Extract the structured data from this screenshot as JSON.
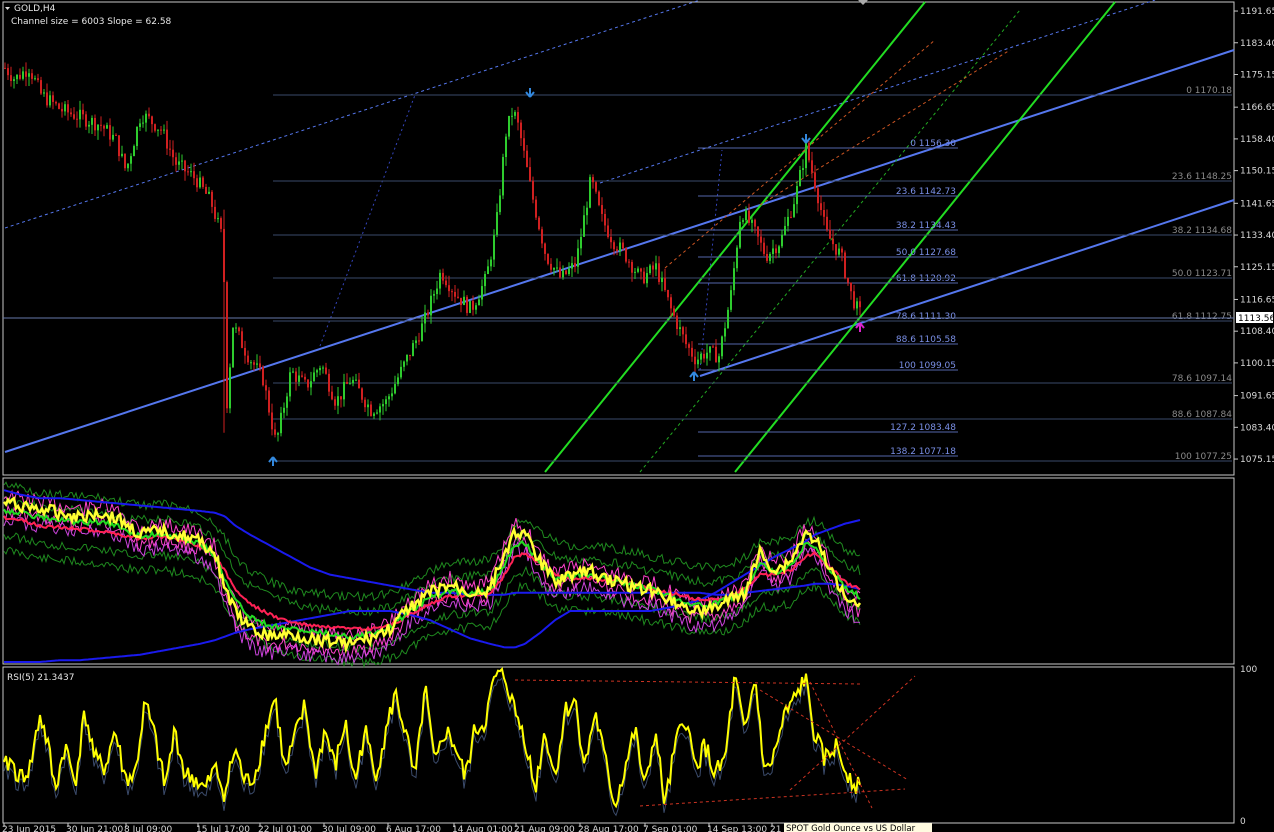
{
  "header": {
    "symbol_title": "GOLD,H4",
    "channel_info": "Channel size = 6003 Slope = 62.58",
    "rsi_title": "RSI(5) 21.3437"
  },
  "bottom_label": "SPOT Gold Ounce vs US Dollar",
  "colors": {
    "background": "#000000",
    "bull_candle": "#2ecc2e",
    "bear_candle": "#d02020",
    "channel_line": "#5577ee",
    "green_channel": "#22dd22",
    "fib_text": "#7a8fe6",
    "rsi_line": "#ffff00",
    "ma_yellow": "#ffff33",
    "ma_blue": "#1a1aee",
    "ma_magenta": "#ff44cc",
    "ma_green": "#1f8a1f",
    "current_price_box": "#ffffff"
  },
  "chart_data": [
    {
      "type": "line",
      "title": "GOLD,H4",
      "ylim": [
        1071,
        1194
      ],
      "y_ticks": [
        "1191.65",
        "1183.40",
        "1175.15",
        "1166.65",
        "1158.40",
        "1150.15",
        "1141.65",
        "1133.40",
        "1125.15",
        "1116.65",
        "1108.40",
        "1100.15",
        "1091.65",
        "1083.40",
        "1075.15"
      ],
      "current_price": "1113.56",
      "x_ticks": [
        "23 Jun 2015",
        "30 Jun 21:00",
        "8 Jul 09:00",
        "15 Jul 17:00",
        "22 Jul 01:00",
        "30 Jul 09:00",
        "6 Aug 17:00",
        "14 Aug 01:00",
        "21 Aug 09:00",
        "28 Aug 17:00",
        "7 Sep 01:00",
        "14 Sep 13:00",
        "21"
      ],
      "series": [
        {
          "name": "GOLD,H4",
          "x": [
            0,
            14,
            28,
            40,
            60,
            80,
            100,
            115,
            125,
            140,
            160,
            175,
            195,
            210,
            222,
            226,
            232,
            245,
            262,
            275,
            290,
            305,
            320,
            335,
            350,
            370,
            385,
            400,
            415,
            425,
            440,
            455,
            470,
            485,
            495,
            505,
            512,
            518,
            530,
            545,
            560,
            575,
            590,
            600,
            612,
            625,
            640,
            655,
            670,
            685,
            695,
            705,
            718,
            730,
            740,
            752,
            765,
            780,
            795,
            805,
            815,
            825,
            840,
            850,
            858
          ],
          "y": [
            1178,
            1174,
            1177,
            1170,
            1166,
            1164,
            1162,
            1158,
            1150,
            1165,
            1161,
            1152,
            1148,
            1142,
            1132,
            1090,
            1110,
            1103,
            1096,
            1079,
            1098,
            1094,
            1100,
            1090,
            1096,
            1088,
            1090,
            1098,
            1106,
            1112,
            1124,
            1118,
            1114,
            1122,
            1135,
            1160,
            1166,
            1161,
            1145,
            1128,
            1122,
            1126,
            1148,
            1138,
            1132,
            1128,
            1122,
            1125,
            1114,
            1105,
            1101,
            1103,
            1102,
            1118,
            1140,
            1135,
            1128,
            1132,
            1144,
            1156,
            1146,
            1134,
            1128,
            1118,
            1113
          ]
        }
      ],
      "fibonacci_levels": [
        {
          "label": "0 1156.30"
        },
        {
          "label": "23.6 1142.73"
        },
        {
          "label": "38.2 1134.43"
        },
        {
          "label": "50.0 1127.68"
        },
        {
          "label": "61.8 1120.92"
        },
        {
          "label": "78.6 1111.30"
        },
        {
          "label": "88.6 1105.58"
        },
        {
          "label": "100 1099.05"
        },
        {
          "label": "127.2 1083.48"
        },
        {
          "label": "138.2 1077.18"
        }
      ],
      "fibonacci_levels_2": [
        {
          "label": "0 1170.18"
        },
        {
          "label": "23.6 1148.25"
        },
        {
          "label": "38.2 1134.68"
        },
        {
          "label": "50.0 1123.71"
        },
        {
          "label": "61.8 1112.75"
        },
        {
          "label": "78.6 1097.14"
        },
        {
          "label": "88.6 1087.84"
        },
        {
          "label": "100 1077.25"
        }
      ]
    },
    {
      "type": "line",
      "x": [
        0,
        20,
        40,
        60,
        80,
        100,
        120,
        140,
        160,
        180,
        200,
        215,
        225,
        235,
        250,
        270,
        290,
        310,
        330,
        350,
        370,
        390,
        410,
        430,
        450,
        470,
        490,
        505,
        515,
        525,
        540,
        555,
        570,
        590,
        610,
        630,
        650,
        670,
        685,
        700,
        715,
        730,
        745,
        760,
        775,
        790,
        805,
        815,
        830,
        845,
        860
      ],
      "series": [
        {
          "name": "",
          "values": [
            0.12,
            0.14,
            0.16,
            0.18,
            0.2,
            0.18,
            0.22,
            0.3,
            0.28,
            0.3,
            0.34,
            0.4,
            0.6,
            0.72,
            0.82,
            0.86,
            0.85,
            0.87,
            0.88,
            0.9,
            0.87,
            0.82,
            0.7,
            0.62,
            0.58,
            0.62,
            0.6,
            0.4,
            0.28,
            0.3,
            0.45,
            0.55,
            0.52,
            0.5,
            0.55,
            0.58,
            0.6,
            0.65,
            0.7,
            0.72,
            0.7,
            0.66,
            0.62,
            0.4,
            0.5,
            0.45,
            0.3,
            0.32,
            0.5,
            0.62,
            0.68
          ]
        },
        {
          "name": "",
          "values": [
            0.2,
            0.22,
            0.25,
            0.26,
            0.27,
            0.28,
            0.3,
            0.32,
            0.31,
            0.33,
            0.36,
            0.42,
            0.5,
            0.6,
            0.68,
            0.74,
            0.78,
            0.8,
            0.81,
            0.82,
            0.82,
            0.8,
            0.74,
            0.68,
            0.64,
            0.63,
            0.62,
            0.52,
            0.42,
            0.4,
            0.46,
            0.52,
            0.54,
            0.54,
            0.55,
            0.57,
            0.6,
            0.62,
            0.64,
            0.66,
            0.66,
            0.64,
            0.6,
            0.52,
            0.52,
            0.5,
            0.42,
            0.4,
            0.48,
            0.56,
            0.6
          ]
        },
        {
          "name": "",
          "values": [
            0.05,
            0.08,
            0.1,
            0.1,
            0.11,
            0.12,
            0.13,
            0.14,
            0.15,
            0.16,
            0.17,
            0.18,
            0.2,
            0.25,
            0.3,
            0.36,
            0.42,
            0.48,
            0.52,
            0.54,
            0.56,
            0.58,
            0.6,
            0.62,
            0.62,
            0.63,
            0.63,
            0.63,
            0.62,
            0.62,
            0.62,
            0.62,
            0.62,
            0.62,
            0.62,
            0.62,
            0.62,
            0.62,
            0.62,
            0.62,
            0.63,
            0.63,
            0.62,
            0.61,
            0.6,
            0.59,
            0.58,
            0.57,
            0.57,
            0.58,
            0.6
          ]
        },
        {
          "name": "",
          "values": [
            0.02,
            0.02,
            0.02,
            0.03,
            0.03,
            0.04,
            0.05,
            0.06,
            0.08,
            0.1,
            0.12,
            0.14,
            0.16,
            0.18,
            0.2,
            0.22,
            0.24,
            0.26,
            0.28,
            0.3,
            0.3,
            0.3,
            0.28,
            0.25,
            0.2,
            0.15,
            0.12,
            0.1,
            0.1,
            0.12,
            0.18,
            0.25,
            0.3,
            0.3,
            0.3,
            0.3,
            0.3,
            0.32,
            0.34,
            0.36,
            0.4,
            0.45,
            0.5,
            0.55,
            0.6,
            0.64,
            0.68,
            0.72,
            0.75,
            0.78,
            0.8
          ]
        }
      ]
    },
    {
      "type": "line",
      "title": "RSI(5) 21.3437",
      "ylim": [
        0,
        100
      ],
      "y_ticks": [
        "100",
        "0"
      ],
      "x": [
        0,
        10,
        20,
        30,
        40,
        48,
        55,
        65,
        75,
        85,
        95,
        105,
        115,
        125,
        135,
        145,
        155,
        165,
        175,
        185,
        195,
        205,
        215,
        225,
        235,
        245,
        255,
        265,
        275,
        285,
        295,
        305,
        315,
        325,
        335,
        345,
        355,
        365,
        375,
        385,
        395,
        405,
        415,
        425,
        435,
        445,
        455,
        465,
        475,
        485,
        495,
        505,
        515,
        525,
        535,
        545,
        555,
        565,
        575,
        585,
        595,
        605,
        615,
        625,
        635,
        645,
        655,
        665,
        675,
        685,
        695,
        705,
        715,
        725,
        735,
        745,
        755,
        765,
        775,
        785,
        795,
        805,
        815,
        825,
        835,
        845,
        855,
        860
      ],
      "values": [
        30,
        40,
        28,
        35,
        70,
        50,
        20,
        50,
        25,
        72,
        40,
        35,
        60,
        28,
        30,
        78,
        55,
        22,
        60,
        30,
        28,
        20,
        35,
        18,
        48,
        25,
        30,
        58,
        82,
        32,
        55,
        76,
        30,
        60,
        35,
        65,
        25,
        60,
        30,
        55,
        84,
        60,
        26,
        88,
        35,
        60,
        50,
        28,
        60,
        65,
        95,
        95,
        72,
        55,
        20,
        60,
        28,
        72,
        80,
        35,
        72,
        40,
        10,
        35,
        60,
        20,
        60,
        10,
        48,
        70,
        35,
        50,
        30,
        40,
        95,
        55,
        95,
        30,
        45,
        70,
        80,
        95,
        55,
        40,
        50,
        35,
        25,
        20
      ]
    }
  ]
}
